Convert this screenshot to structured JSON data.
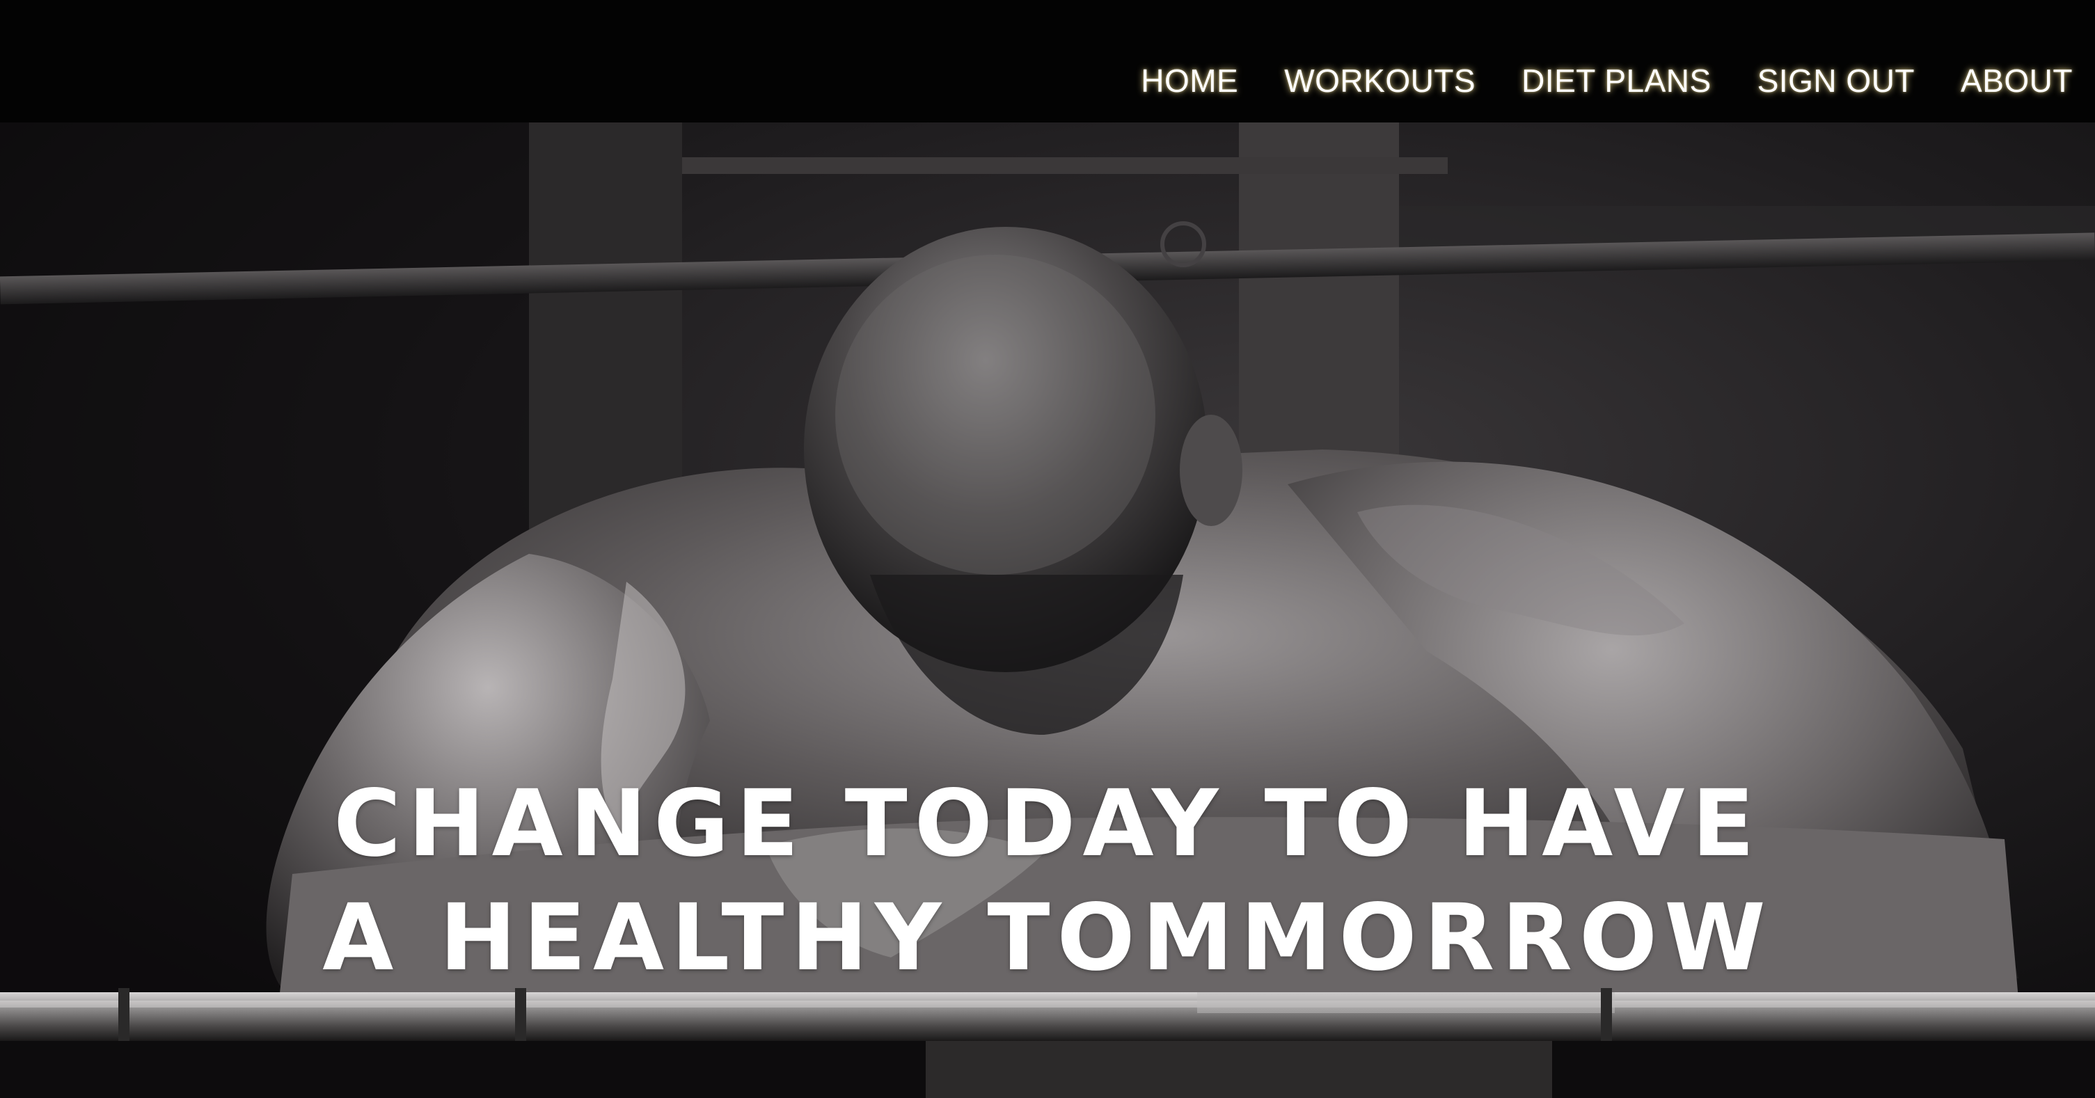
{
  "nav": {
    "items": [
      {
        "label": "HOME"
      },
      {
        "label": "WORKOUTS"
      },
      {
        "label": "DIET PLANS"
      },
      {
        "label": "SIGN OUT"
      },
      {
        "label": "ABOUT"
      }
    ]
  },
  "hero": {
    "headline_line1": "CHANGE TODAY TO HAVE",
    "headline_line2": "A HEALTHY TOMMORROW"
  },
  "colors": {
    "topbar_bg": "#030303",
    "nav_text": "#ffffff",
    "nav_glow": "#ebd78c",
    "headline_text": "#ffffff"
  }
}
